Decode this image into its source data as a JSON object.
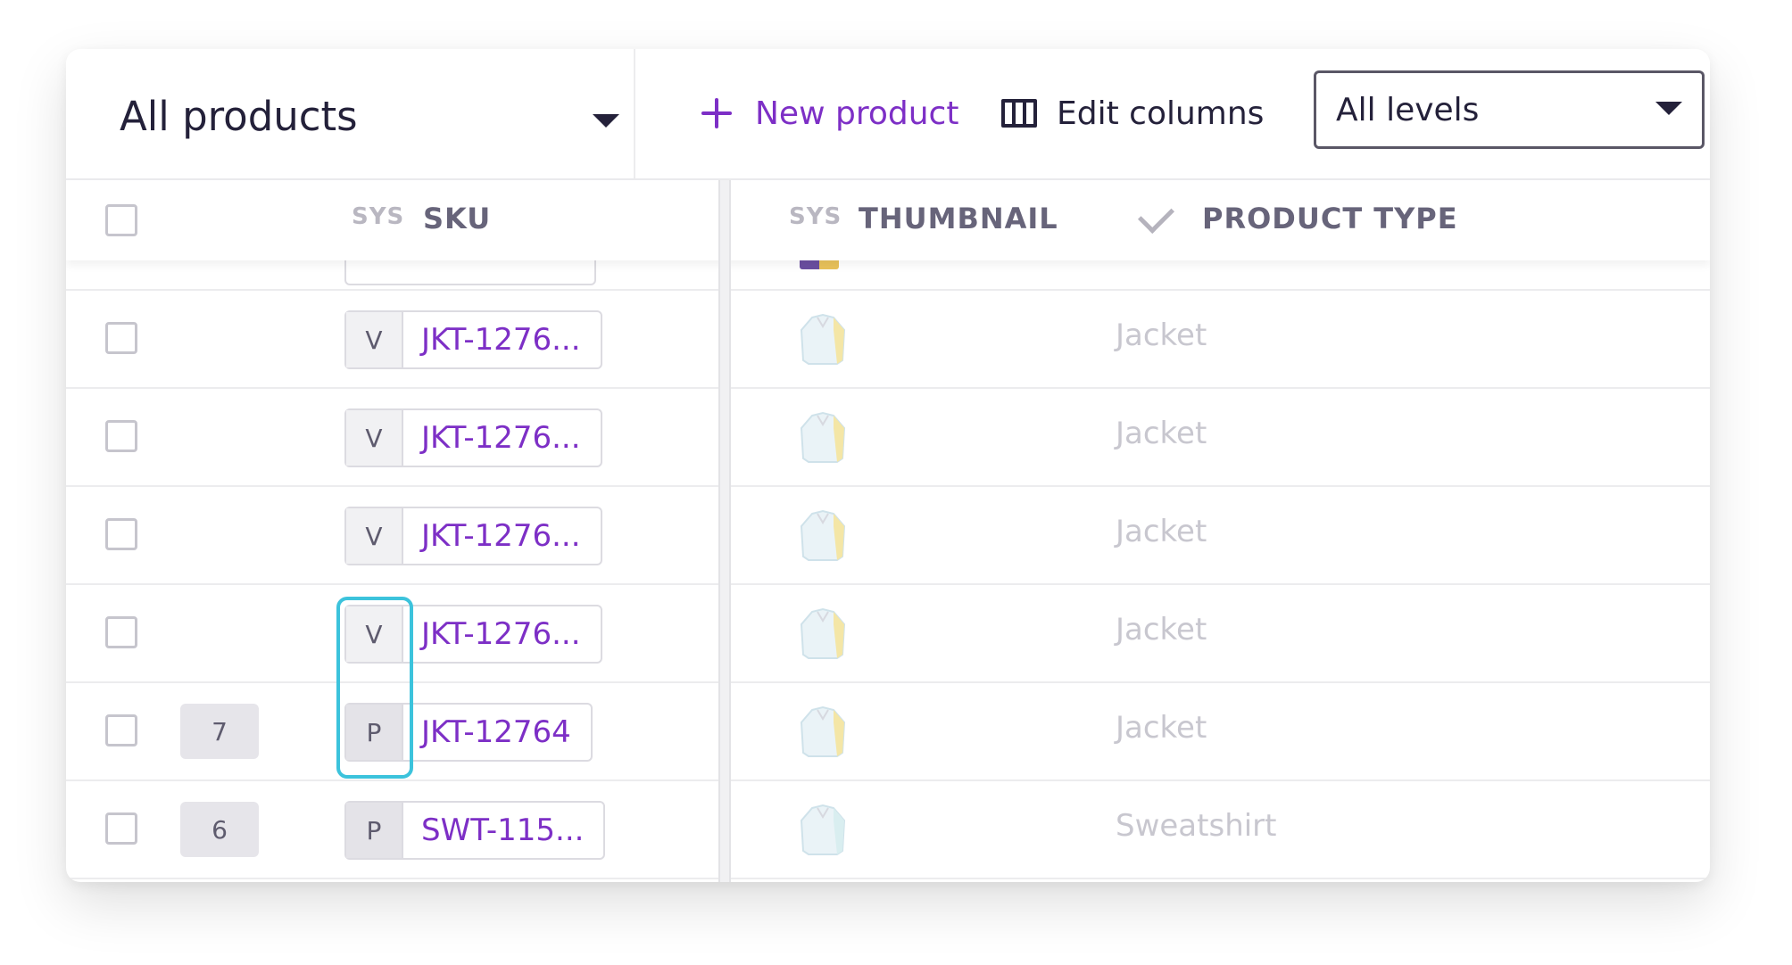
{
  "toolbar": {
    "catalog_title": "All products",
    "new_product_label": "New product",
    "edit_columns_label": "Edit columns",
    "level_filter_value": "All levels"
  },
  "columns": {
    "sku": {
      "sys_tag": "SYS",
      "label": "SKU"
    },
    "thumbnail": {
      "sys_tag": "SYS",
      "label": "THUMBNAIL"
    },
    "product_type": {
      "label": "PRODUCT TYPE"
    }
  },
  "rows": [
    {
      "count": "",
      "level": "V",
      "sku": "JKT-1276...",
      "product_type": "Jacket",
      "thumb_color": "#f4e6a6"
    },
    {
      "count": "",
      "level": "V",
      "sku": "JKT-1276...",
      "product_type": "Jacket",
      "thumb_color": "#f4e6a6"
    },
    {
      "count": "",
      "level": "V",
      "sku": "JKT-1276...",
      "product_type": "Jacket",
      "thumb_color": "#f4e6a6"
    },
    {
      "count": "",
      "level": "V",
      "sku": "JKT-1276...",
      "product_type": "Jacket",
      "thumb_color": "#f4e6a6"
    },
    {
      "count": "7",
      "level": "P",
      "sku": "JKT-12764",
      "product_type": "Jacket",
      "thumb_color": "#f4e6a6"
    },
    {
      "count": "6",
      "level": "P",
      "sku": "SWT-115...",
      "product_type": "Sweatshirt",
      "thumb_color": "#d9eef0"
    }
  ],
  "colors": {
    "accent": "#7d2fc6",
    "highlight": "#3cc3dc"
  }
}
